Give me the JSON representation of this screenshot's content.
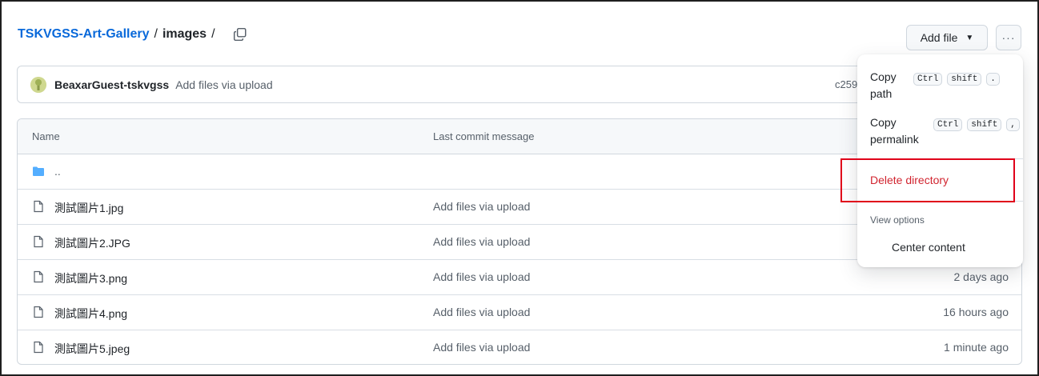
{
  "breadcrumb": {
    "repo": "TSKVGSS-Art-Gallery",
    "separator": "/",
    "dir": "images",
    "trailing": "/"
  },
  "header": {
    "add_file_label": "Add file",
    "more_label": "···"
  },
  "commit": {
    "user": "BeaxarGuest-tskvgss",
    "message": "Add files via upload",
    "hash": "c259"
  },
  "table": {
    "columns": {
      "name": "Name",
      "message": "Last commit message"
    },
    "parent": "..",
    "rows": [
      {
        "name": "測試圖片1.jpg",
        "message": "Add files via upload",
        "date": ""
      },
      {
        "name": "測試圖片2.JPG",
        "message": "Add files via upload",
        "date": ""
      },
      {
        "name": "測試圖片3.png",
        "message": "Add files via upload",
        "date": "2 days ago"
      },
      {
        "name": "測試圖片4.png",
        "message": "Add files via upload",
        "date": "16 hours ago"
      },
      {
        "name": "測試圖片5.jpeg",
        "message": "Add files via upload",
        "date": "1 minute ago"
      }
    ]
  },
  "menu": {
    "copy_path": {
      "line1": "Copy",
      "line2": "path",
      "keys": [
        "Ctrl",
        "shift",
        "."
      ]
    },
    "copy_permalink": {
      "line1": "Copy",
      "line2": "permalink",
      "keys": [
        "Ctrl",
        "shift",
        ","
      ]
    },
    "delete_label": "Delete directory",
    "view_options_heading": "View options",
    "center_content_label": "Center content"
  },
  "colors": {
    "link": "#0969da",
    "danger": "#d1242f",
    "highlight": "#e0001a"
  }
}
